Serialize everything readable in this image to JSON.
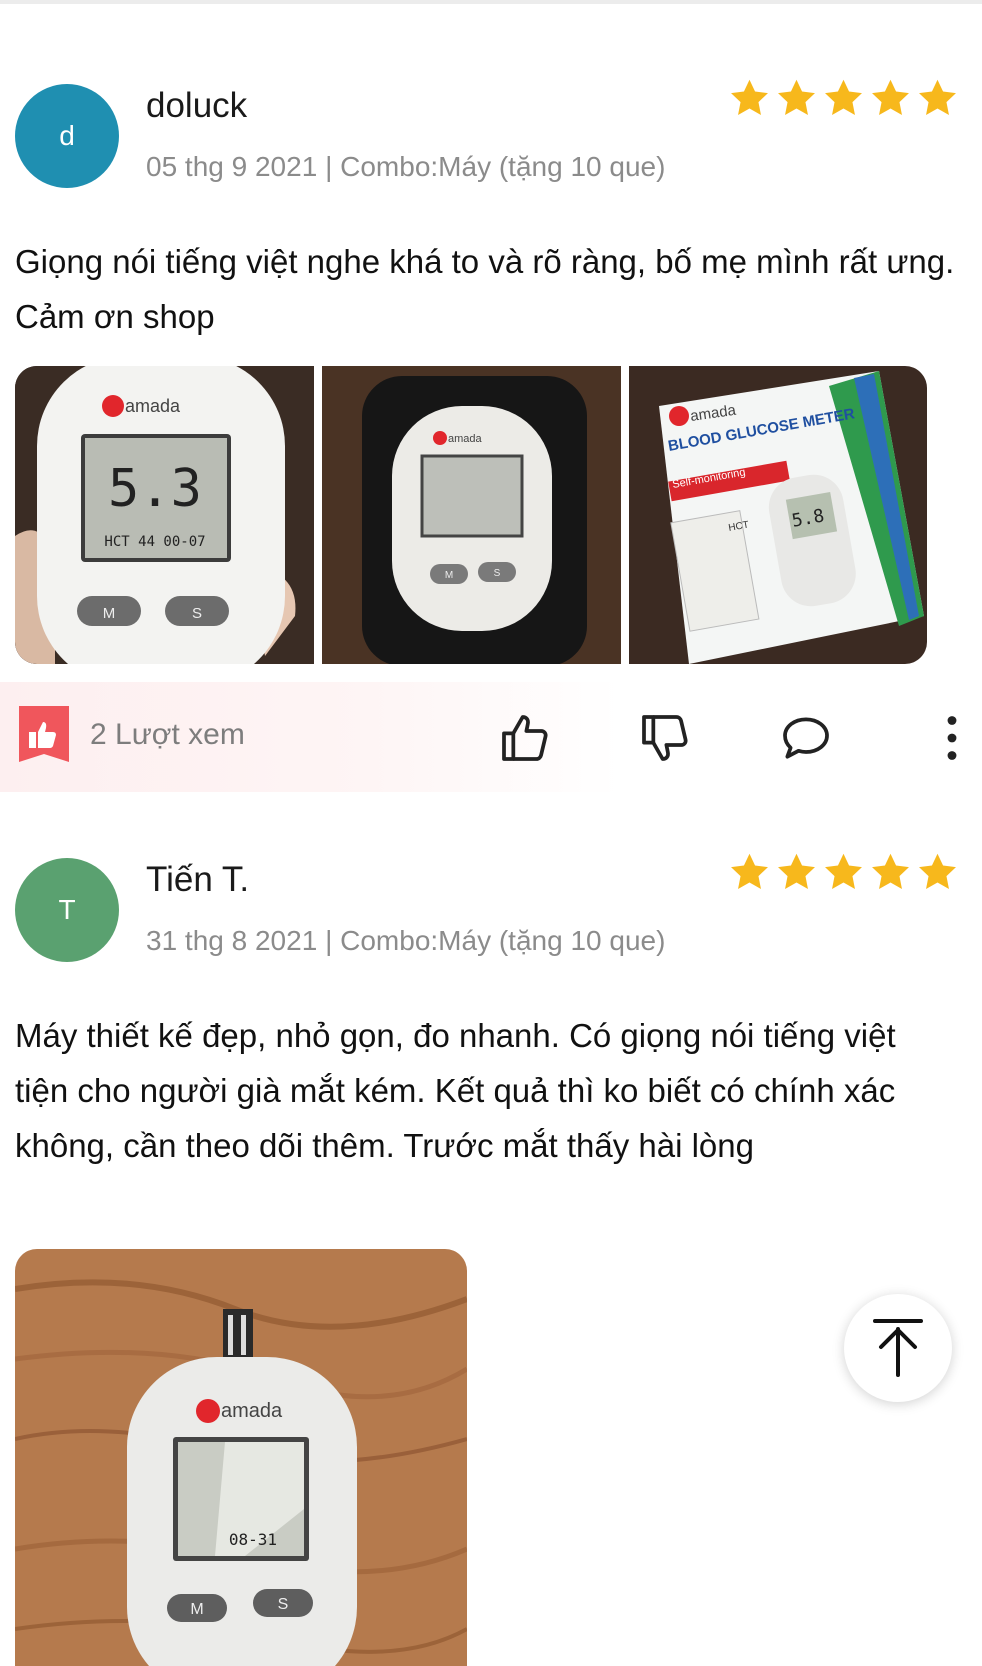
{
  "reviews": [
    {
      "avatar_letter": "d",
      "avatar_color": "#1f8fb1",
      "username": "doluck",
      "date": "05 thg 9 2021",
      "variant": "Combo:Máy (tặng 10 que)",
      "rating": 5,
      "text": "Giọng nói tiếng việt nghe khá to và rõ ràng, bố mẹ mình rất ưng. Cảm ơn shop",
      "photos": [
        {
          "brand": "amada",
          "reading": "5.3",
          "subtext": "HCT 44  00-07",
          "key_m": "M",
          "key_s": "S"
        },
        {
          "brand": "amada",
          "key_m": "M",
          "key_s": "S"
        },
        {
          "brand": "amada",
          "box_title": "BLOOD GLUCOSE METER",
          "box_label": "Self-monitoring",
          "reading": "5.8",
          "box_tag": "HCT"
        }
      ],
      "views": "2 Lượt xem"
    },
    {
      "avatar_letter": "T",
      "avatar_color": "#5aa170",
      "username": "Tiến T.",
      "date": "31 thg 8 2021",
      "variant": "Combo:Máy (tặng 10 que)",
      "rating": 5,
      "text": "Máy thiết kế đẹp, nhỏ gọn, đo nhanh. Có giọng nói tiếng việt tiện cho người già mắt kém. Kết quả thì ko biết có chính xác không, cần theo dõi thêm. Trước mắt thấy hài lòng",
      "photos": [
        {
          "brand": "amada",
          "reading": "08-31",
          "key_m": "M",
          "key_s": "S"
        }
      ]
    }
  ],
  "colors": {
    "star": "#f7b81c",
    "like_badge": "#f0565c",
    "brand_red": "#e1262c",
    "icon_stroke": "#222222"
  },
  "icons": {
    "like": "thumbs-up-icon",
    "dislike": "thumbs-down-icon",
    "comment": "comment-icon",
    "more": "more-vertical-icon",
    "scroll_top": "arrow-up-to-top-icon"
  }
}
